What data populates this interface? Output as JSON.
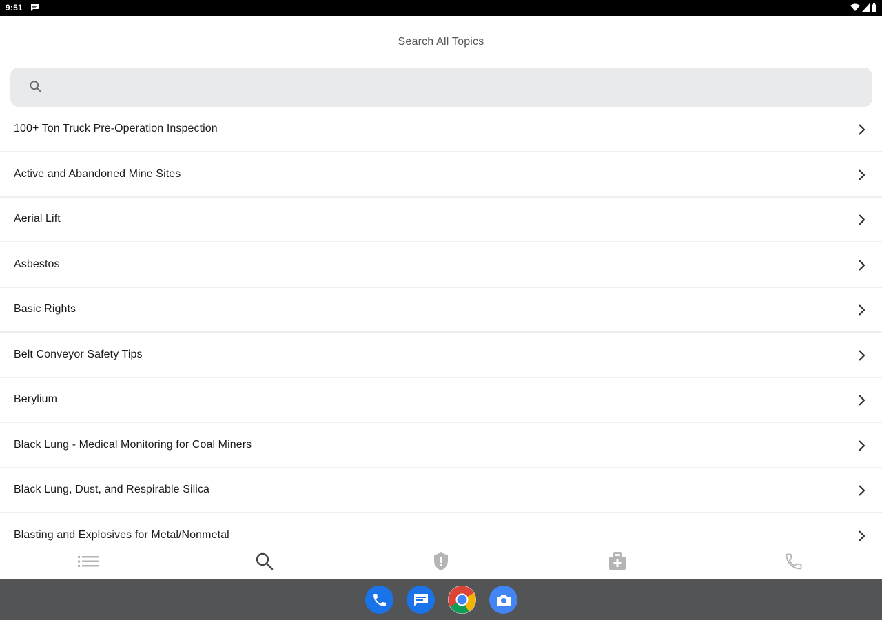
{
  "status_bar": {
    "time": "9:51",
    "icons": [
      "message-icon",
      "wifi-icon",
      "signal-icon",
      "battery-icon"
    ]
  },
  "header": {
    "title": "Search All Topics"
  },
  "search": {
    "placeholder": "",
    "value": "",
    "icon": "search-icon"
  },
  "topics": [
    {
      "label": "100+ Ton Truck Pre-Operation Inspection"
    },
    {
      "label": "Active and Abandoned Mine Sites"
    },
    {
      "label": "Aerial Lift"
    },
    {
      "label": "Asbestos"
    },
    {
      "label": "Basic Rights"
    },
    {
      "label": "Belt Conveyor Safety Tips"
    },
    {
      "label": "Berylium"
    },
    {
      "label": "Black Lung - Medical Monitoring for Coal Miners"
    },
    {
      "label": "Black Lung, Dust, and Respirable Silica"
    },
    {
      "label": "Blasting and Explosives for Metal/Nonmetal"
    }
  ],
  "tab_bar": {
    "tabs": [
      {
        "name": "list",
        "icon": "list-icon",
        "active": false
      },
      {
        "name": "search",
        "icon": "search-icon",
        "active": true
      },
      {
        "name": "safety",
        "icon": "shield-icon",
        "active": false
      },
      {
        "name": "first-aid",
        "icon": "first-aid-kit-icon",
        "active": false
      },
      {
        "name": "call",
        "icon": "phone-icon",
        "active": false
      }
    ]
  },
  "dock": {
    "apps": [
      "phone-icon",
      "messages-icon",
      "chrome-icon",
      "camera-icon"
    ]
  },
  "colors": {
    "search_bg": "#e9eaec",
    "tab_active": "#444444",
    "tab_inactive": "#b5b5b5",
    "dock_bg": "#535456",
    "dock_app_blue": "#1a73e8"
  }
}
